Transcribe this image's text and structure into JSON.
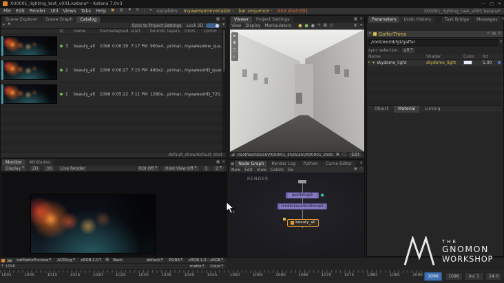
{
  "titlebar": {
    "title": "X00001_lighting_test_v001.katana* - Katana 7.0v3"
  },
  "menubar": {
    "menus": [
      "File",
      "Edit",
      "Render",
      "Util",
      "Views",
      "Tabs",
      "Help"
    ],
    "variables_label": "variables:",
    "variable_a": "myawesomevariable -",
    "variable_b": "bar sequence -",
    "variable_d": "XXX shot-001",
    "project_name": "X00001_lighting_task_v001.katana*"
  },
  "catalog": {
    "tabs": [
      "Scene Explorer",
      "Scene Graph",
      "Catalog"
    ],
    "sync_button": "Sync to Project Settings",
    "lock_label": "Lock 2D",
    "columns": [
      "IC",
      "name",
      "frame",
      "elapsed",
      "start",
      "bounds",
      "layers",
      "GSVs",
      "comm"
    ],
    "rows": [
      {
        "num": "3",
        "name": "beauty_all",
        "frame": "1096",
        "elapsed": "0:00:30",
        "start": "7:17 PM",
        "bounds": "960x4...",
        "layers": "primar...",
        "gsvs": "myaweso...",
        "comm": "low_qua..."
      },
      {
        "num": "2",
        "name": "beauty_all",
        "frame": "1096",
        "elapsed": "0:00:27",
        "start": "7:15 PM",
        "bounds": "480x2...",
        "layers": "primar...",
        "gsvs": "myaweso...",
        "comm": "HD_quar..."
      },
      {
        "num": "1",
        "name": "beauty_all",
        "frame": "1096",
        "elapsed": "0:05:22",
        "start": "7:11 PM",
        "bounds": "1280x...",
        "layers": "primar...",
        "gsvs": "myaweso...",
        "comm": "HD_720..."
      }
    ],
    "footer": "default_show/default_shot"
  },
  "monitor": {
    "tabs": [
      "Monitor",
      "Attributes"
    ],
    "toolbar": {
      "display": "Display",
      "two_d": "2D",
      "three_d": "3D",
      "live": "Live Render",
      "roi": "ROI Off",
      "hold": "Hold View Off",
      "b1": "1",
      "b2": "2"
    },
    "footer": {
      "pass": "catMattePreview",
      "cs": "ACEScg",
      "view": "sRGB 1.0",
      "back": "Back",
      "preset": "default",
      "channels": "RGBA",
      "transform": "sRGB 1.0 - sRGB",
      "frame": "1096",
      "matte": "matte",
      "color": "Color"
    }
  },
  "viewer": {
    "tabs": [
      "Viewer",
      "Project Settings"
    ],
    "menus": [
      "View",
      "Display",
      "Manipulators"
    ],
    "camera_path": "/root/world/cam/X00001_shotcam/X00001_shotcamShap",
    "edit": "Edit"
  },
  "nodegraph": {
    "tabs": [
      "Node Graph",
      "Render Log",
      "Python",
      "Curve Editor"
    ],
    "menus": [
      "New",
      "Edit",
      "View",
      "Colors",
      "Go"
    ],
    "backdrop": "RENDER",
    "node_aov": "aovSetupS",
    "node_loc": "renderLocationSetupS",
    "node_render": "beauty_all"
  },
  "parameters": {
    "tabs": [
      "Parameters",
      "Undo History",
      "Task Bridge",
      "Messages"
    ],
    "node_type": "GafferThree",
    "path": "/root/world/lgt/gaffer",
    "sync_label": "sync selection:",
    "sync_value": "off",
    "columns": [
      "Name",
      "Shader",
      "Color",
      "Int"
    ],
    "light_name": "skydome_light",
    "light_shader": "skydome_light",
    "light_int": "1.00",
    "bottom_tabs": [
      "Object",
      "Material",
      "Linking"
    ]
  },
  "timeline": {
    "labels": [
      "1001",
      "1005",
      "1010",
      "1015",
      "1020",
      "1025",
      "1030",
      "1035",
      "1040",
      "1045",
      "1050",
      "1055",
      "1060",
      "1065",
      "1070",
      "1075",
      "1080",
      "1085",
      "1090"
    ],
    "current": "1096",
    "out": "1096",
    "inc_label": "Inc",
    "inc_value": "1",
    "fps": "24.0"
  },
  "watermark": {
    "l1": "THE",
    "l2": "GNOMON",
    "l3": "WORKSHOP"
  }
}
